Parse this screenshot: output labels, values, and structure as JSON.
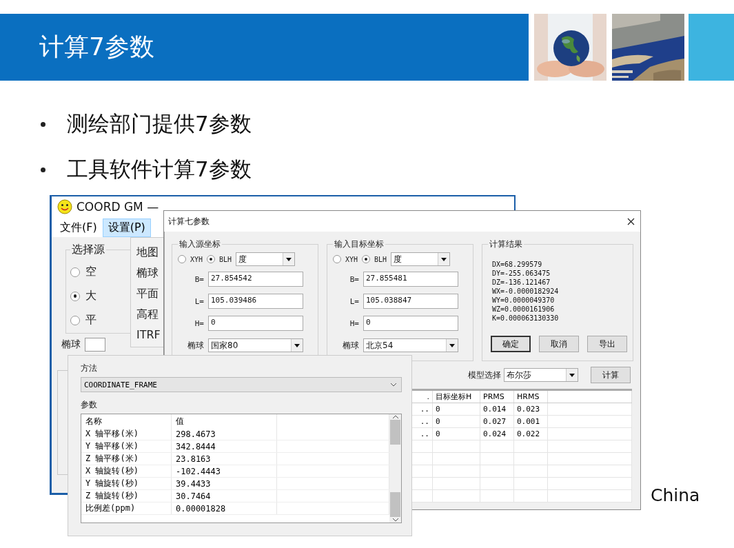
{
  "slide": {
    "title": "计算7参数",
    "pictures": [
      {
        "kind": "picture"
      },
      {
        "kind": "picture"
      }
    ],
    "bullets": [
      "测绘部门提供7参数",
      "工具软件计算7参数"
    ],
    "logo_text": "China"
  },
  "main_window": {
    "title": "COORD GM —",
    "menu": [
      {
        "label": "文件(F)",
        "selected": false
      },
      {
        "label": "设置(P)",
        "selected": true
      }
    ],
    "dropdown": [
      "地图",
      "椭球",
      "平面",
      "高程",
      "ITRF"
    ],
    "group_title": "选择源",
    "radios": [
      {
        "label": "空",
        "selected": false
      },
      {
        "label": "大",
        "selected": true
      },
      {
        "label": "平",
        "selected": false
      }
    ],
    "ellipsoid_label": "椭球"
  },
  "dialog": {
    "title": "计算七参数",
    "groups": [
      {
        "title": "输入源坐标",
        "radios": [
          {
            "label": "XYH",
            "selected": false
          },
          {
            "label": "BLH",
            "selected": true
          }
        ],
        "unit": "度",
        "fields": [
          {
            "label": "B=",
            "value": "27.854542"
          },
          {
            "label": "L=",
            "value": "105.039486"
          },
          {
            "label": "H=",
            "value": "0"
          }
        ],
        "ellipsoid": {
          "label": "椭球",
          "value": "国家80"
        }
      },
      {
        "title": "输入目标坐标",
        "radios": [
          {
            "label": "XYH",
            "selected": false
          },
          {
            "label": "BLH",
            "selected": true
          }
        ],
        "unit": "度",
        "fields": [
          {
            "label": "B=",
            "value": "27.855481"
          },
          {
            "label": "L=",
            "value": "105.038847"
          },
          {
            "label": "H=",
            "value": "0"
          }
        ],
        "ellipsoid": {
          "label": "椭球",
          "value": "北京54"
        }
      }
    ],
    "results": {
      "title": "计算结果",
      "lines": [
        "DX=68.299579",
        "DY=-255.063475",
        "DZ=-136.121467",
        "WX=-0.0000182924",
        "WY=0.0000049370",
        "WZ=0.0000161906",
        "K=0.000063130330"
      ],
      "buttons": [
        {
          "label": "确定",
          "default": true
        },
        {
          "label": "取消",
          "default": false
        },
        {
          "label": "导出",
          "default": false
        }
      ]
    },
    "model_label": "模型选择",
    "model": "布尔莎",
    "calc_button": "计算",
    "table": {
      "columns": [
        ".",
        "目标坐标H",
        "PRMS",
        "HRMS"
      ],
      "rows": [
        [
          "..",
          "0",
          "0.014",
          "0.023"
        ],
        [
          "..",
          "0",
          "0.027",
          "0.001"
        ],
        [
          "..",
          "0",
          "0.024",
          "0.022"
        ]
      ]
    }
  },
  "params_panel": {
    "method_label": "方法",
    "method": "COORDINATE_FRAME",
    "params_label": "参数",
    "columns": [
      "名称",
      "值"
    ],
    "rows": [
      [
        "X 轴平移(米)",
        "298.4673"
      ],
      [
        "Y 轴平移(米)",
        "342.8444"
      ],
      [
        "Z 轴平移(米)",
        "23.8163"
      ],
      [
        "X 轴旋转(秒)",
        "-102.4443"
      ],
      [
        "Y 轴旋转(秒)",
        "39.4433"
      ],
      [
        "Z 轴旋转(秒)",
        "30.7464"
      ],
      [
        "比例差(ppm)",
        "0.00001828"
      ]
    ]
  }
}
